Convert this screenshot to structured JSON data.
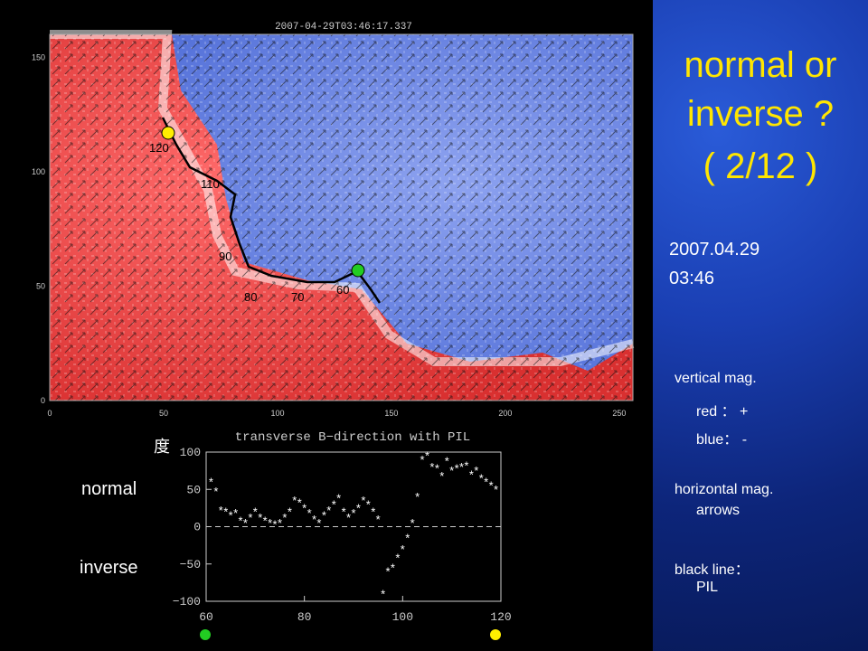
{
  "side_panel": {
    "title_line1": "normal or",
    "title_line2": "inverse ?",
    "title_line3": "( 2/12 )",
    "date": "2007.04.29",
    "time": "03:46",
    "legend": {
      "vertical": "vertical mag.",
      "red": "red ： +",
      "blue": "blue： -",
      "horizontal": "horizontal mag.",
      "arrows": "arrows",
      "black_line": "black line：",
      "pil": "PIL"
    },
    "colors": {
      "title": "#ffe600",
      "background": "#1a3fb3"
    }
  },
  "map": {
    "timestamp": "2007-04-29T03:46:17.337",
    "pil_labels": [
      "120",
      "110",
      "90",
      "80",
      "70",
      "60"
    ],
    "marker_colors": {
      "start": "#ffee00",
      "end": "#22cc22"
    }
  },
  "left_labels": {
    "normal": "normal",
    "inverse": "inverse",
    "unit": "度"
  },
  "chart_data": [
    {
      "type": "heatmap",
      "title": "2007-04-29T03:46:17.337",
      "xlabel": "",
      "ylabel": "",
      "xlim": [
        0,
        256
      ],
      "ylim": [
        0,
        160
      ],
      "x_ticks": [
        0,
        50,
        100,
        150,
        200,
        250
      ],
      "y_ticks": [
        0,
        50,
        100,
        150
      ],
      "color_scale": {
        "positive": "red",
        "negative": "blue"
      }
    },
    {
      "type": "scatter",
      "title": "transverse B−direction with PIL",
      "xlabel": "",
      "ylabel": "",
      "xlim": [
        60,
        120
      ],
      "ylim": [
        -100,
        100
      ],
      "x_ticks": [
        60,
        80,
        100,
        120
      ],
      "y_ticks": [
        100,
        50,
        0,
        -50,
        -100
      ],
      "reference_line": 0,
      "marker": "*",
      "x": [
        61,
        62,
        63,
        64,
        65,
        66,
        67,
        68,
        69,
        70,
        71,
        72,
        73,
        74,
        75,
        76,
        77,
        78,
        79,
        80,
        81,
        82,
        83,
        84,
        85,
        86,
        87,
        88,
        89,
        90,
        91,
        92,
        93,
        94,
        95,
        96,
        97,
        98,
        99,
        100,
        101,
        102,
        103,
        104,
        105,
        106,
        107,
        108,
        109,
        110,
        111,
        112,
        113,
        114,
        115,
        116,
        117,
        118,
        119
      ],
      "y": [
        60,
        47,
        22,
        20,
        15,
        18,
        8,
        5,
        12,
        20,
        12,
        8,
        5,
        3,
        5,
        12,
        20,
        35,
        32,
        25,
        18,
        10,
        5,
        15,
        22,
        30,
        38,
        20,
        12,
        18,
        25,
        35,
        30,
        20,
        10,
        -90,
        -60,
        -55,
        -42,
        -30,
        -15,
        5,
        40,
        90,
        95,
        80,
        78,
        68,
        88,
        75,
        78,
        80,
        82,
        70,
        75,
        65,
        60,
        55,
        50
      ],
      "note_points_visible": true
    }
  ]
}
